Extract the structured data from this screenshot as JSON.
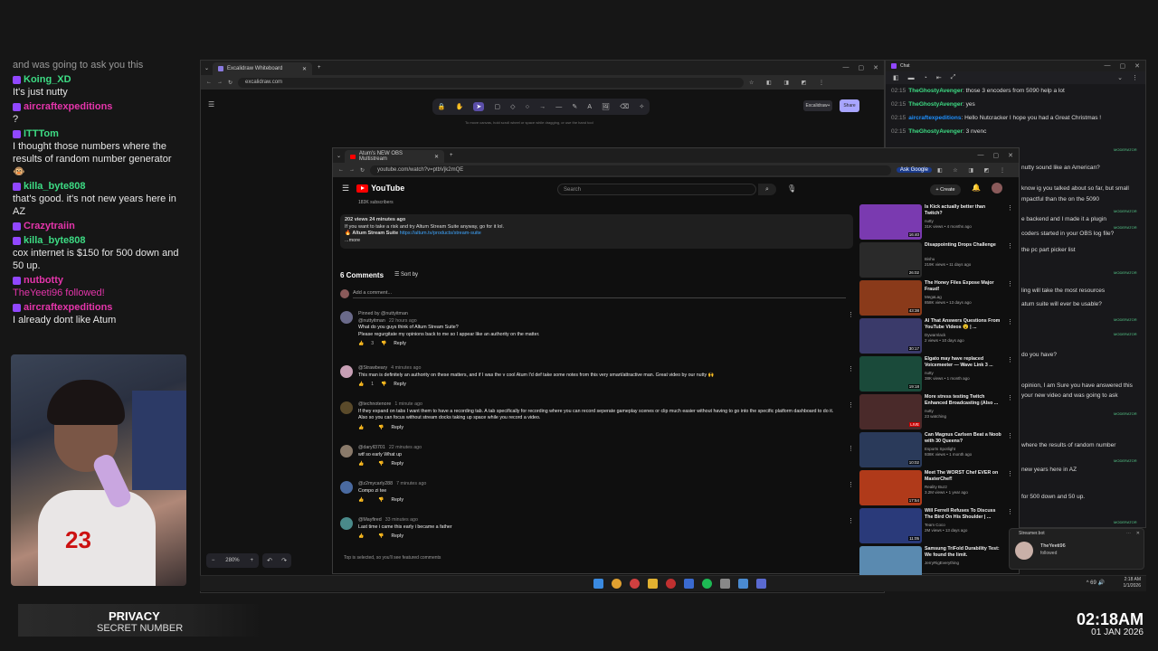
{
  "stream_chat": {
    "partial_line": "and was going to ask you this",
    "messages": [
      {
        "user": "Koing_XD",
        "color": "#3ddc84",
        "text": "It's just nutty"
      },
      {
        "user": "aircraftexpeditions",
        "color": "#e535ab",
        "text": "?"
      },
      {
        "user": "ITTTom",
        "color": "#3ddc84",
        "text": "I thought those numbers where the results of random number generator 🐵"
      },
      {
        "user": "killa_byte808",
        "color": "#3ddc84",
        "text": "that's good. it's not new years here in AZ"
      },
      {
        "user": "Crazytraiin",
        "color": "#e535ab",
        "text": ""
      },
      {
        "user": "killa_byte808",
        "color": "#3ddc84",
        "text": "cox internet is $150 for 500 down and 50 up."
      },
      {
        "user": "nutbotty",
        "color": "#e535ab",
        "text": "TheYeeti96 followed!"
      },
      {
        "user": "aircraftexpeditions",
        "color": "#e535ab",
        "text": "I already dont like Atum"
      }
    ]
  },
  "overlay": {
    "privacy_title": "PRIVACY",
    "privacy_sub": "SECRET NUMBER",
    "time": "02:18AM",
    "date": "01 JAN 2026"
  },
  "excalidraw": {
    "tab_title": "Excalidraw Whiteboard",
    "url": "excalidraw.com",
    "hint": "To move canvas, hold scroll wheel or space while dragging, or use the hand tool",
    "library_label": "Excalidraw+",
    "share_label": "Share",
    "zoom": "280%",
    "tools": [
      "🔒",
      "✋",
      "➤",
      "▢",
      "◇",
      "○",
      "→",
      "—",
      "✎",
      "A",
      "🖼",
      "⌫",
      "✧"
    ]
  },
  "chat_window": {
    "title": "Chat",
    "lines": [
      {
        "time": "02:15",
        "user": "TheGhostyAvenger",
        "color": "#3ddc84",
        "text": "those 3 encoders from 5090 help a lot"
      },
      {
        "time": "02:15",
        "user": "TheGhostyAvenger",
        "color": "#3ddc84",
        "text": "yes"
      },
      {
        "time": "02:15",
        "user": "aircraftexpeditions",
        "color": "#1e90ff",
        "text": "Hello Nutcracker I hope you had a Great Christmas !"
      },
      {
        "time": "02:15",
        "user": "TheGhostyAvenger",
        "color": "#3ddc84",
        "text": "3 nvenc"
      }
    ],
    "side_fragments": [
      "nutty sound like an American?",
      "know ig you talked about so far, but small",
      "mpactful than the on the 5090",
      "e backend and I made it a plugin",
      "coders started in your OBS log file?",
      "the pc part picker list",
      "ling will take the most resources",
      "atum suite will ever be usable?",
      "do you have?",
      "opinion, I am Sure you have answered this",
      "your new video and was going to ask",
      "where the results of random number",
      "new years here in AZ",
      "for 500 down and 50 up."
    ],
    "badge": "MODERATOR"
  },
  "youtube": {
    "tab_title": "Atum's NEW OBS Multistream",
    "url": "youtube.com/watch?v=ptbVjk2mQE",
    "ask_google": "Ask Google",
    "search_placeholder": "Search",
    "create_label": "Create",
    "logo_text": "YouTube",
    "subscribers": "183K subscribers",
    "description": {
      "stats": "202 views  24 minutes ago",
      "line1": "If you want to take a risk and try Altum Stream Suite anyway, go for it lol.",
      "link_label": "Altum Stream Suite",
      "link_url": "https://altum.tv/products/stream-suite",
      "more": "...more"
    },
    "comments_count": "6 Comments",
    "sort_label": "Sort by",
    "add_comment": "Add a comment...",
    "comments": [
      {
        "pinned": "Pinned by @nuttyitman",
        "author": "@nuttyitman",
        "time": "22 hours ago",
        "text": "What do you guys think of Altum Stream Suite?\nPlease regurgitate my opinions back to me so I appear like an authority on the matter.",
        "likes": "3",
        "reply": "Reply",
        "avatar": "#6a6a8a"
      },
      {
        "author": "@Strawbeary",
        "time": "4 minutes ago",
        "text": "This man is definitely an authority on these matters, and if I was the v cool Atum I'd def take some notes from this very smart/attractive man. Great video by our nutty 🙌",
        "likes": "1",
        "reply": "Reply",
        "avatar": "#c79fb5"
      },
      {
        "author": "@technotenore",
        "time": "1 minute ago",
        "text": "If they expand on tabs I want them to have a recording tab. A tab specifically for recording where you can record seperate gameplay scenes or clip much easier without having to go into the specific platform dashboard to do it. Also so you can focus without stream docks taking up space while you record a video.",
        "likes": "",
        "reply": "Reply",
        "avatar": "#5a4a2a"
      },
      {
        "author": "@daryll3701",
        "time": "22 minutes ago",
        "text": "wtf so early What up",
        "likes": "",
        "reply": "Reply",
        "avatar": "#8a7a6a"
      },
      {
        "author": "@z2mycarly288",
        "time": "7 minutes ago",
        "text": "Compo zi tee",
        "likes": "",
        "reply": "Reply",
        "avatar": "#4a6aa0"
      },
      {
        "author": "@Mayfired",
        "time": "33 minutes ago",
        "text": "Last time i came this early i became a father",
        "likes": "",
        "reply": "Reply",
        "avatar": "#4a8a8a"
      }
    ],
    "footer": "Top is selected, so you'll see featured comments",
    "recommendations": [
      {
        "title": "Is Kick actually better than Twitch?",
        "channel": "nutty",
        "meta": "31K views • 4 months ago",
        "dur": "16:40",
        "thumb": "#7a3ab0"
      },
      {
        "title": "Disappointing Drops Challenge",
        "channel": "Bishu",
        "meta": "219K views • 11 days ago",
        "dur": "26:02",
        "thumb": "#2a2a2a"
      },
      {
        "title": "The Honey Files Expose Major Fraud!",
        "channel": "MegaLag",
        "meta": "858K views • 13 days ago",
        "dur": "43:38",
        "thumb": "#8a3a1a"
      },
      {
        "title": "AI That Answers Questions From YouTube Videos 😮 | ...",
        "channel": "Dywarnlack",
        "meta": "2 views • 10 days ago",
        "dur": "30:17",
        "thumb": "#3a3a6a"
      },
      {
        "title": "Elgato may have replaced Voicemeeter — Wave Link 3 ...",
        "channel": "nutty",
        "meta": "38K views • 1 month ago",
        "dur": "19:18",
        "thumb": "#1a4a3a"
      },
      {
        "title": "More stress testing Twitch Enhanced Broadcasting (Also ...",
        "channel": "nutty",
        "meta": "23 watching",
        "dur": "LIVE",
        "thumb": "#4a2a2a"
      },
      {
        "title": "Can Magnus Carlsen Beat a Noob with 30 Queens?",
        "channel": "Esports Spotlight",
        "meta": "938K views • 1 month ago",
        "dur": "10:02",
        "thumb": "#2a3a5a"
      },
      {
        "title": "Meet The WORST Chef EVER on MasterChef!",
        "channel": "Reality Buzz",
        "meta": "3.2M views • 1 year ago",
        "dur": "17:54",
        "thumb": "#b03a1a"
      },
      {
        "title": "Will Ferrell Refuses To Discuss The Bird On His Shoulder | ...",
        "channel": "Team Coco",
        "meta": "2M views • 13 days ago",
        "dur": "11:05",
        "thumb": "#2a3a7a"
      },
      {
        "title": "Samsung TriFold Durability Test: We found the limit.",
        "channel": "JerryRigEverything",
        "meta": "",
        "dur": "",
        "thumb": "#5a8ab0"
      }
    ]
  },
  "toast": {
    "app": "Streamer.bot",
    "name": "TheYeeti96",
    "message": "followed"
  },
  "taskbar": {
    "tray": "^  69  🔊",
    "time": "2:18 AM",
    "date": "1/1/2026"
  }
}
